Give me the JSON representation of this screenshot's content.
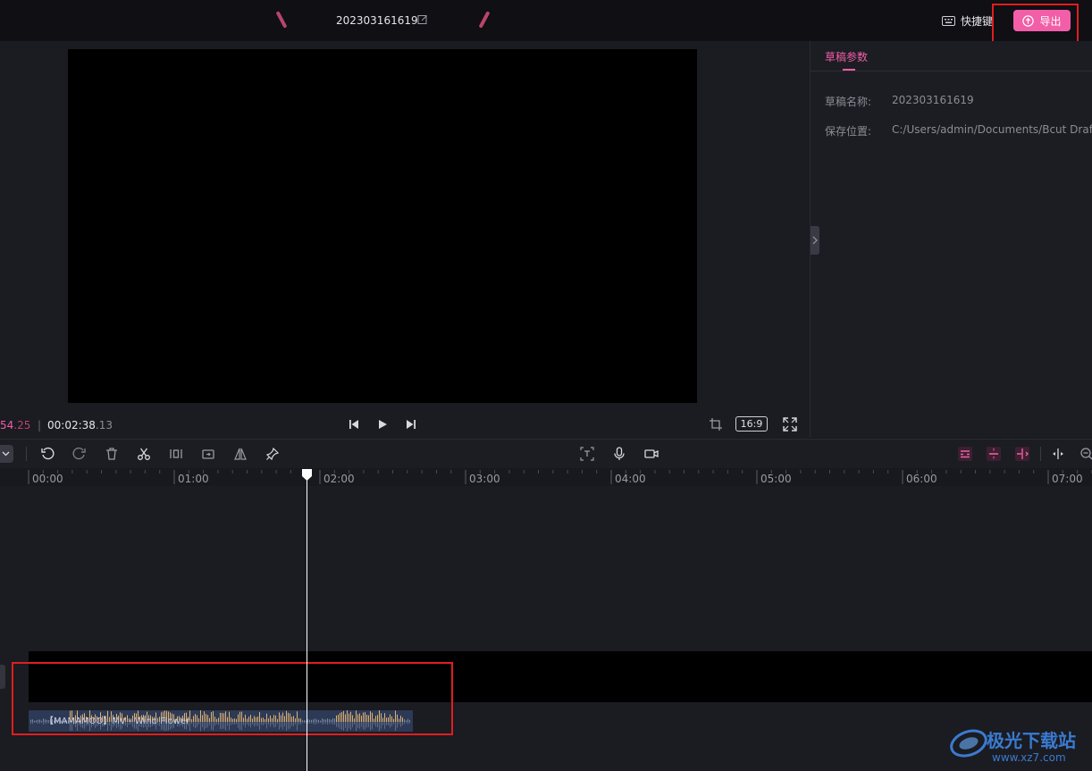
{
  "topbar": {
    "project_name": "202303161619",
    "shortcut_label": "快捷键",
    "export_label": "导出"
  },
  "preview": {
    "current_time": "54",
    "current_frames": ".25",
    "total_time": "00:02:38",
    "total_frames": ".13",
    "aspect_ratio": "16:9"
  },
  "panel": {
    "tab_label": "草稿参数",
    "name_label": "草稿名称:",
    "name_value": "202303161619",
    "path_label": "保存位置:",
    "path_value": "C:/Users/admin/Documents/Bcut Drafts"
  },
  "timeline": {
    "ruler": [
      "00:00",
      "01:00",
      "02:00",
      "03:00",
      "04:00",
      "05:00",
      "06:00",
      "07:00"
    ],
    "audio_clip_label": "【MAMAMOO】MV - Wind Flower"
  },
  "watermark": {
    "brand": "极光下载站",
    "url": "www.xz7.com"
  },
  "colors": {
    "accent": "#f25ea7",
    "highlight_box": "#e01e1e"
  }
}
